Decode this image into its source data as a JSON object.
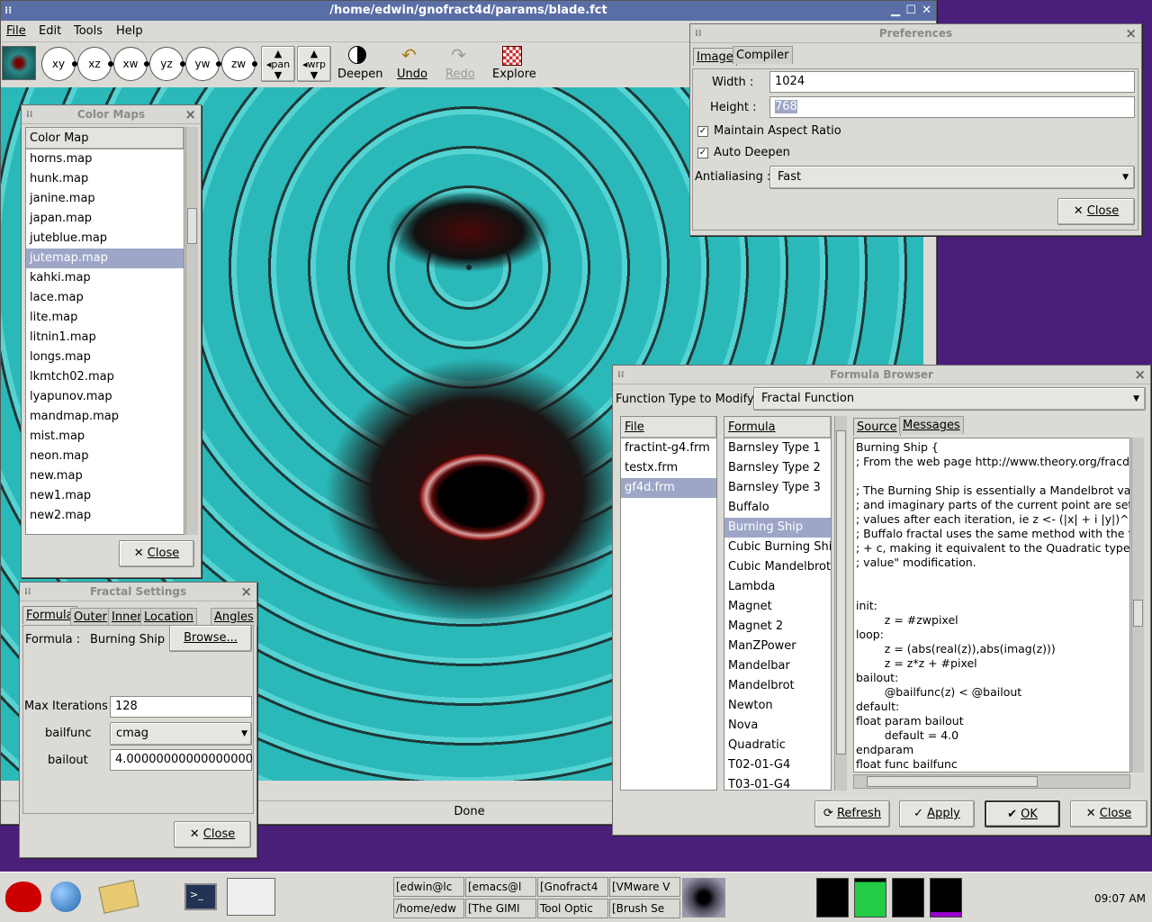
{
  "main_window": {
    "title": "/home/edwin/gnofract4d/params/blade.fct",
    "menu": [
      "File",
      "Edit",
      "Tools",
      "Help"
    ],
    "toolbar_planes": [
      "xy",
      "xz",
      "xw",
      "yz",
      "yw",
      "zw"
    ],
    "toolbar_pan": "pan",
    "toolbar_warp": "wrp",
    "deepen_label": "Deepen",
    "undo_label": "Undo",
    "redo_label": "Redo",
    "explore_label": "Explore",
    "status": "Done"
  },
  "color_maps": {
    "title": "Color Maps",
    "column_header": "Color Map",
    "items": [
      "horns.map",
      "hunk.map",
      "janine.map",
      "japan.map",
      "juteblue.map",
      "jutemap.map",
      "kahki.map",
      "lace.map",
      "lite.map",
      "litnin1.map",
      "longs.map",
      "lkmtch02.map",
      "lyapunov.map",
      "mandmap.map",
      "mist.map",
      "neon.map",
      "new.map",
      "new1.map",
      "new2.map"
    ],
    "selected": "jutemap.map",
    "close_label": "Close"
  },
  "fractal_settings": {
    "title": "Fractal Settings",
    "tabs": [
      "Formula",
      "Outer",
      "Inner",
      "Location",
      "Angles"
    ],
    "formula_label": "Formula :",
    "formula_value": "Burning Ship",
    "browse_label": "Browse...",
    "max_iter_label": "Max Iterations :",
    "max_iter_value": "128",
    "bailfunc_label": "bailfunc",
    "bailfunc_value": "cmag",
    "bailout_label": "bailout",
    "bailout_value": "4.00000000000000000",
    "close_label": "Close"
  },
  "preferences": {
    "title": "Preferences",
    "tabs": [
      "Image",
      "Compiler"
    ],
    "width_label": "Width :",
    "width_value": "1024",
    "height_label": "Height :",
    "height_value": "768",
    "maintain_aspect_label": "Maintain Aspect Ratio",
    "auto_deepen_label": "Auto Deepen",
    "antialias_label": "Antialiasing :",
    "antialias_value": "Fast",
    "close_label": "Close"
  },
  "formula_browser": {
    "title": "Formula Browser",
    "function_type_label": "Function Type to Modify :",
    "function_type_value": "Fractal Function",
    "file_header": "File",
    "files": [
      "fractint-g4.frm",
      "testx.frm",
      "gf4d.frm"
    ],
    "selected_file": "gf4d.frm",
    "formula_header": "Formula",
    "formulas": [
      "Barnsley Type 1",
      "Barnsley Type 2",
      "Barnsley Type 3",
      "Buffalo",
      "Burning Ship",
      "Cubic Burning Ship",
      "Cubic Mandelbrot",
      "Lambda",
      "Magnet",
      "Magnet 2",
      "ManZPower",
      "Mandelbar",
      "Mandelbrot",
      "Newton",
      "Nova",
      "Quadratic",
      "T02-01-G4",
      "T03-01-G4"
    ],
    "selected_formula": "Burning Ship",
    "source_tabs": [
      "Source",
      "Messages"
    ],
    "source_text": "Burning Ship {\n; From the web page http://www.theory.org/fracdyn/\n\n; The Burning Ship is essentially a Mandelbrot variar\n; and imaginary parts of the current point are set to tl\n; values after each iteration, ie z <- (|x| + i |y|)^2 + c.\n; Buffalo fractal uses the same method with the func\n; + c, making it equivalent to the Quadratic type with\n; value\" modification.\n\n\ninit:\n        z = #zwpixel\nloop:\n        z = (abs(real(z)),abs(imag(z)))\n        z = z*z + #pixel\nbailout:\n        @bailfunc(z) < @bailout\ndefault:\nfloat param bailout\n        default = 4.0\nendparam\nfloat func bailfunc",
    "refresh_label": "Refresh",
    "apply_label": "Apply",
    "ok_label": "OK",
    "close_label": "Close"
  },
  "taskbar": {
    "tasks_row1": [
      "[edwin@lc",
      "[emacs@l",
      "[Gnofract4",
      "[VMware V"
    ],
    "tasks_row2": [
      "/home/edw",
      "[The GIMI",
      "Tool Optic",
      "[Brush Se"
    ],
    "clock": "09:07 AM"
  },
  "colors": {
    "desktop": "#4a1f7a",
    "window_bg": "#dcdad5",
    "selection": "#9ea6c8",
    "fractal_cyan": "#2bb8b8"
  }
}
